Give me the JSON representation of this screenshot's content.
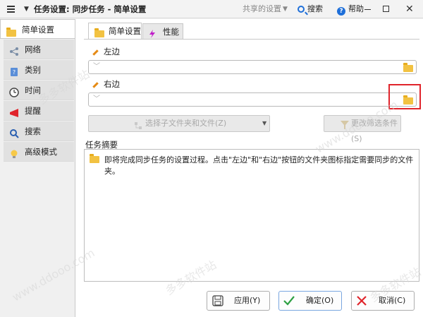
{
  "titlebar": {
    "title": "任务设置: 同步任务 - 简单设置",
    "shared_settings": "共享的设置",
    "search": "搜索",
    "help": "帮助",
    "help_glyph": "?"
  },
  "sidebar": {
    "items": [
      {
        "label": "简单设置",
        "icon": "folder-icon"
      },
      {
        "label": "网络",
        "icon": "network-icon"
      },
      {
        "label": "类别",
        "icon": "category-icon"
      },
      {
        "label": "时间",
        "icon": "clock-icon"
      },
      {
        "label": "提醒",
        "icon": "megaphone-icon"
      },
      {
        "label": "搜索",
        "icon": "search-icon"
      },
      {
        "label": "高级模式",
        "icon": "lightbulb-icon"
      }
    ]
  },
  "tabs": [
    {
      "label": "简单设置",
      "icon": "folder-icon"
    },
    {
      "label": "性能",
      "icon": "lightning-icon"
    }
  ],
  "left_field": {
    "label": "左边",
    "value": ""
  },
  "right_field": {
    "label": "右边",
    "value": ""
  },
  "select_subfolders_button": "选择子文件夹和文件(Z)",
  "filter_button": "更改筛选条件(S)",
  "summary": {
    "label": "任务摘要",
    "message": "即将完成同步任务的设置过程。点击\"左边\"和\"右边\"按钮的文件夹图标指定需要同步的文件夹。"
  },
  "footer": {
    "apply": "应用(Y)",
    "ok": "确定(O)",
    "cancel": "取消(C)"
  },
  "watermarks": [
    "多多软件站",
    "www.ddooo.com"
  ],
  "colors": {
    "highlight": "#e0242b",
    "accent": "#1e6fd9",
    "folder": "#f2c242"
  }
}
